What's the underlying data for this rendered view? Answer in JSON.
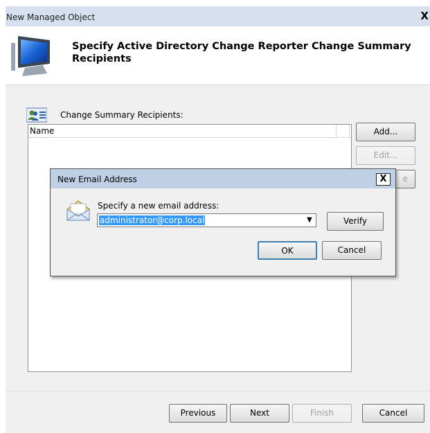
{
  "window": {
    "title": "New Managed Object",
    "close_glyph": "X",
    "heading": "Specify Active Directory Change Reporter Change Summary Recipients"
  },
  "recipients": {
    "label": "Change Summary Recipients:",
    "column_name": "Name",
    "rows": []
  },
  "side_buttons": {
    "add": "Add...",
    "edit": "Edit...",
    "remove_partial": "e"
  },
  "nav_buttons": {
    "previous": "Previous",
    "next": "Next",
    "finish": "Finish",
    "cancel": "Cancel"
  },
  "email_dialog": {
    "title": "New Email Address",
    "close_glyph": "X",
    "prompt": "Specify a new email address:",
    "email_value": "administrator@corp.local",
    "dropdown_glyph": "▼",
    "verify": "Verify",
    "ok": "OK",
    "cancel": "Cancel"
  },
  "colors": {
    "title_bar": "#d6e0ee",
    "dialog_title_bar": "#bfd0e6",
    "selection": "#3399ff",
    "default_button_border": "#3c7fb1"
  },
  "icons": {
    "wizard": "monitor-icon",
    "recipients": "people-list-icon",
    "email": "envelope-icon"
  }
}
